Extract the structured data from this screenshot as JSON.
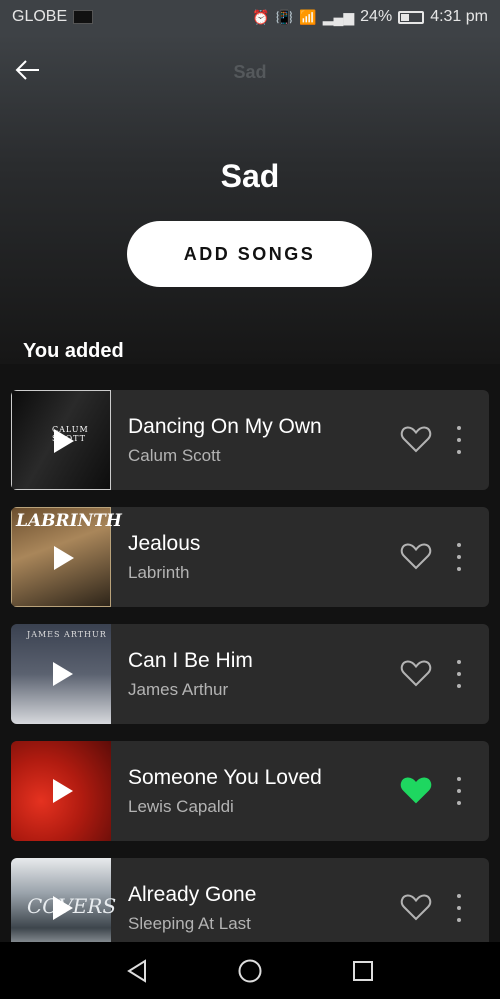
{
  "status_bar": {
    "carrier": "GLOBE",
    "battery": "24%",
    "time": "4:31 pm"
  },
  "header": {
    "title": "Sad"
  },
  "playlist": {
    "title": "Sad",
    "add_button_label": "ADD SONGS"
  },
  "section": {
    "title": "You added"
  },
  "tracks": [
    {
      "title": "Dancing On My Own",
      "artist": "Calum Scott",
      "liked": false,
      "cover_text": "CALUM SCOTT"
    },
    {
      "title": "Jealous",
      "artist": "Labrinth",
      "liked": false,
      "cover_text": "LABRINTH"
    },
    {
      "title": "Can I Be Him",
      "artist": "James Arthur",
      "liked": false,
      "cover_text": "JAMES ARTHUR"
    },
    {
      "title": "Someone You Loved",
      "artist": "Lewis Capaldi",
      "liked": true,
      "cover_text": ""
    },
    {
      "title": "Already Gone",
      "artist": "Sleeping At Last",
      "liked": false,
      "cover_text": "COVERS"
    }
  ],
  "colors": {
    "accent_green": "#1ed760",
    "card_bg": "#2b2b2b",
    "secondary_text": "#b3b3b3"
  }
}
